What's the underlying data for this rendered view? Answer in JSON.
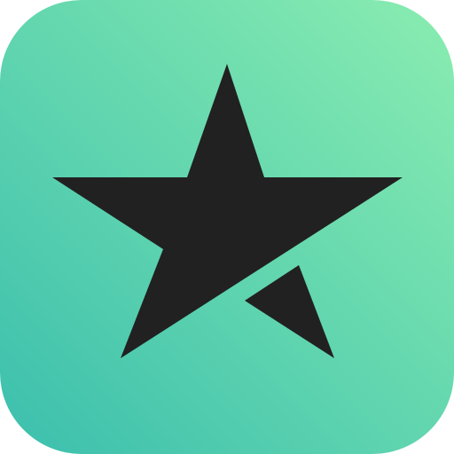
{
  "icon": {
    "name": "star-logo-icon",
    "gradient_start": "#3BBFAE",
    "gradient_end": "#8AEDB0",
    "glyph_color": "#212121"
  }
}
